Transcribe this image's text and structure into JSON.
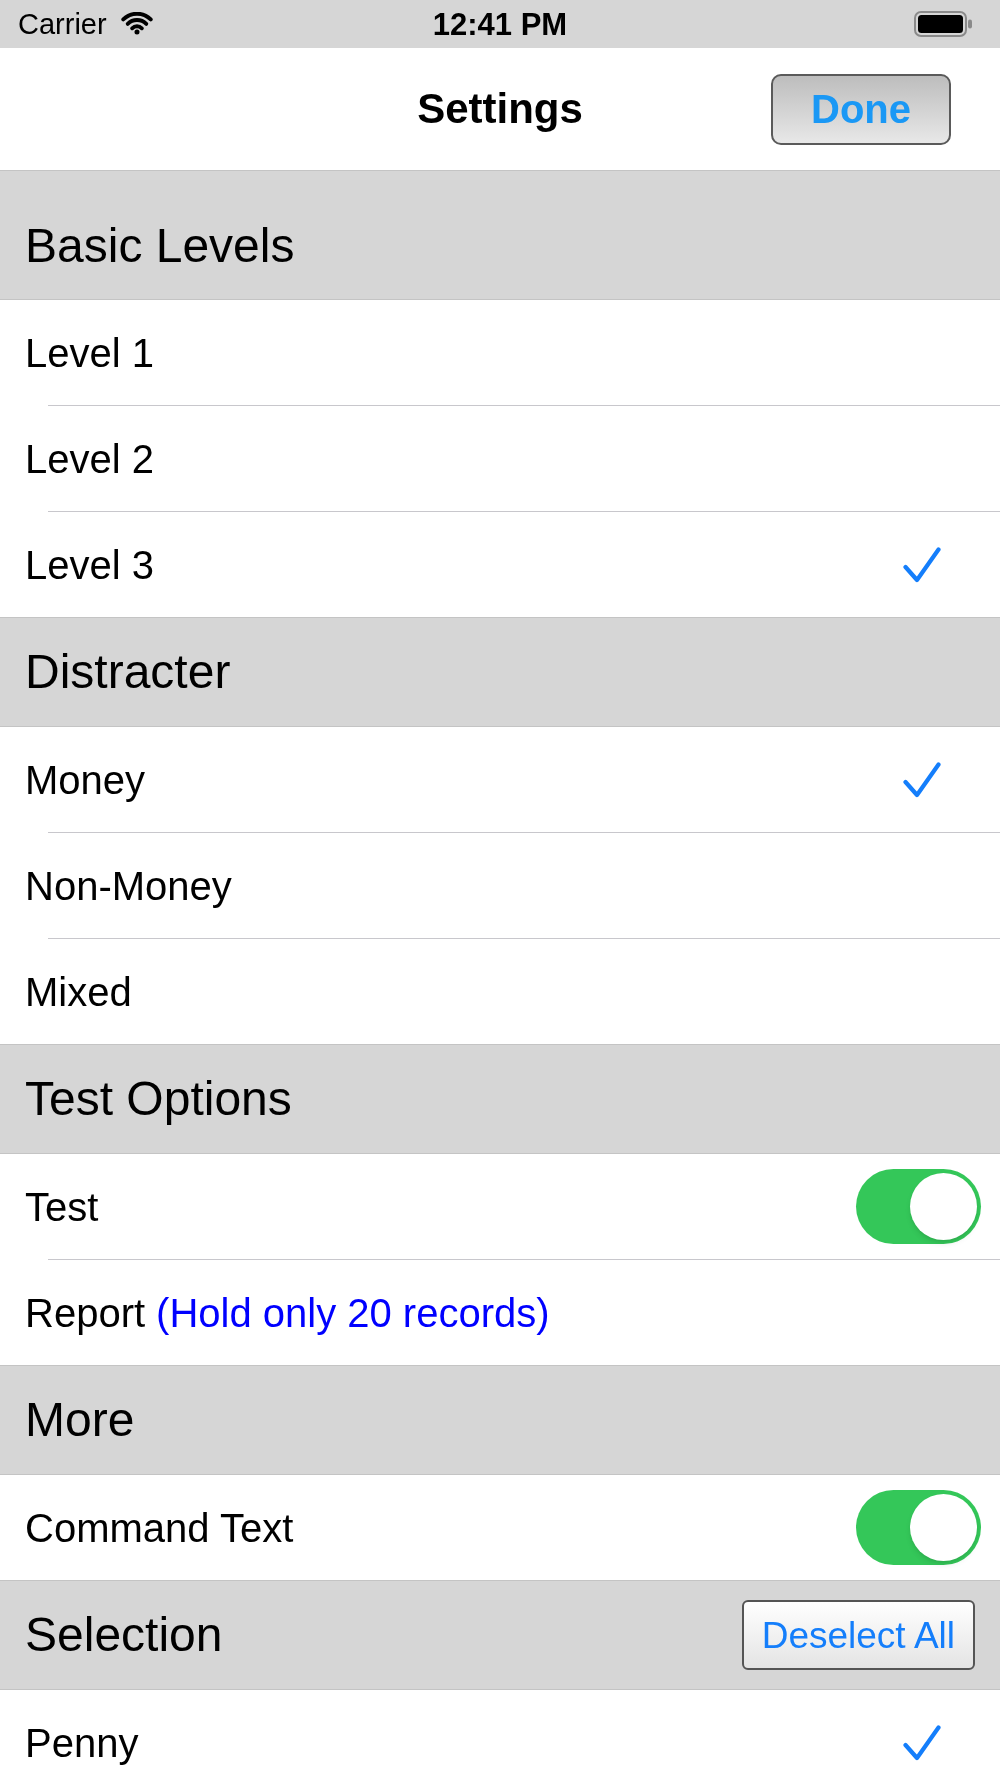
{
  "status_bar": {
    "carrier": "Carrier",
    "time": "12:41 PM"
  },
  "nav_bar": {
    "title": "Settings",
    "done_button": "Done"
  },
  "sections": [
    {
      "title": "Basic Levels",
      "rows": [
        {
          "kind": "check",
          "label": "Level 1",
          "selected": false
        },
        {
          "kind": "check",
          "label": "Level 2",
          "selected": false
        },
        {
          "kind": "check",
          "label": "Level 3",
          "selected": true
        }
      ]
    },
    {
      "title": "Distracter",
      "rows": [
        {
          "kind": "check",
          "label": "Money",
          "selected": true
        },
        {
          "kind": "check",
          "label": "Non-Money",
          "selected": false
        },
        {
          "kind": "check",
          "label": "Mixed",
          "selected": false
        }
      ]
    },
    {
      "title": "Test Options",
      "rows": [
        {
          "kind": "toggle",
          "label": "Test",
          "on": true
        },
        {
          "kind": "text",
          "label": "Report",
          "note": "(Hold only 20 records)"
        }
      ]
    },
    {
      "title": "More",
      "rows": [
        {
          "kind": "toggle",
          "label": "Command Text",
          "on": true
        }
      ]
    },
    {
      "title": "Selection",
      "button": "Deselect All",
      "rows": [
        {
          "kind": "check",
          "label": "Penny",
          "selected": true
        }
      ]
    }
  ]
}
